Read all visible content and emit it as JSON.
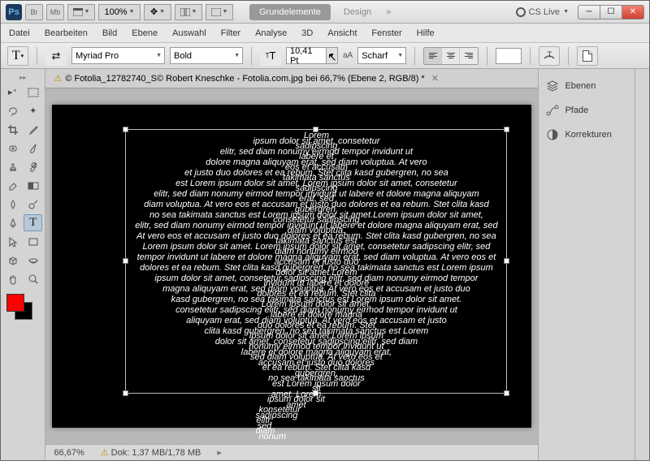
{
  "title": {
    "ps": "Ps",
    "br": "Br",
    "mb": "Mb",
    "zoom": "100%",
    "grundelemente": "Grundelemente",
    "design": "Design",
    "cslive": "CS Live"
  },
  "menu": [
    "Datei",
    "Bearbeiten",
    "Bild",
    "Ebene",
    "Auswahl",
    "Filter",
    "Analyse",
    "3D",
    "Ansicht",
    "Fenster",
    "Hilfe"
  ],
  "opt": {
    "font": "Myriad Pro",
    "weight": "Bold",
    "size": "10,41 Pt",
    "aa": "Scharf",
    "aa_label": "aA"
  },
  "doc": {
    "tab": "© Fotolia_12782740_S© Robert Kneschke - Fotolia.com.jpg bei 66,7% (Ebene 2, RGB/8) *"
  },
  "status": {
    "zoom": "66,67%",
    "doc": "Dok: 1,37 MB/1,78 MB"
  },
  "panels": {
    "ebenen": "Ebenen",
    "pfade": "Pfade",
    "korrekturen": "Korrekturen"
  },
  "lorem": "Lorem ipsum dolor sit amet, consetetur sadipscing elitr, sed diam nonumy eirmod tempor invidunt ut labere et dolore magna aliquyam erat, sed diam voluptua. At vero eos et accusam et justo duo dolores et ea rebum. Stet clita kasd gubergren, no sea takimata sanctus est Lorem ipsum dolor sit amet."
}
